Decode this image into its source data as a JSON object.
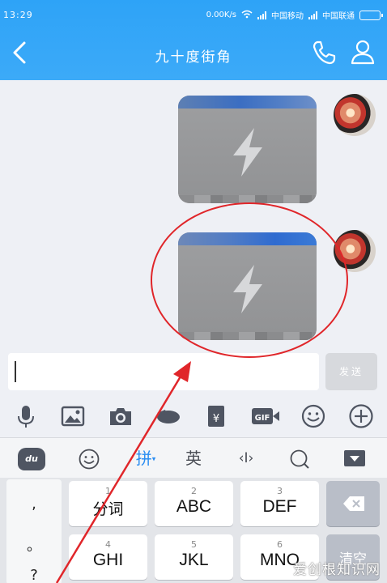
{
  "statusbar": {
    "time": "13:29",
    "speed": "0.00K/s",
    "carrier1": "中国移动",
    "carrier2": "中国联通"
  },
  "header": {
    "title": "九十度街角",
    "back_icon": "chevron-left-icon",
    "call_icon": "phone-icon",
    "profile_icon": "person-icon"
  },
  "chat": {
    "messages": [
      {
        "type": "image",
        "sender": "me"
      },
      {
        "type": "image",
        "sender": "me",
        "highlighted": true
      }
    ]
  },
  "composer": {
    "text": "",
    "send_label": "发送"
  },
  "tools": [
    "microphone-icon",
    "image-icon",
    "camera-icon",
    "red-packet-call-icon",
    "red-envelope-icon",
    "gif-icon",
    "emoji-icon",
    "plus-icon"
  ],
  "ime": {
    "logo": "du",
    "pinyin_label": "拼",
    "english_label": "英",
    "cursor_label": "‹I›"
  },
  "keyboard": {
    "side": [
      ",",
      "。",
      "?"
    ],
    "keys": [
      {
        "num": "1",
        "label": "分词"
      },
      {
        "num": "2",
        "label": "ABC"
      },
      {
        "num": "3",
        "label": "DEF"
      },
      {
        "num": "4",
        "label": "GHI"
      },
      {
        "num": "5",
        "label": "JKL"
      },
      {
        "num": "6",
        "label": "MNO"
      }
    ],
    "clear_label": "清空"
  },
  "watermark": "爱创根知识网",
  "colors": {
    "header": "#2ea3f7",
    "annotation": "#e0262a"
  }
}
